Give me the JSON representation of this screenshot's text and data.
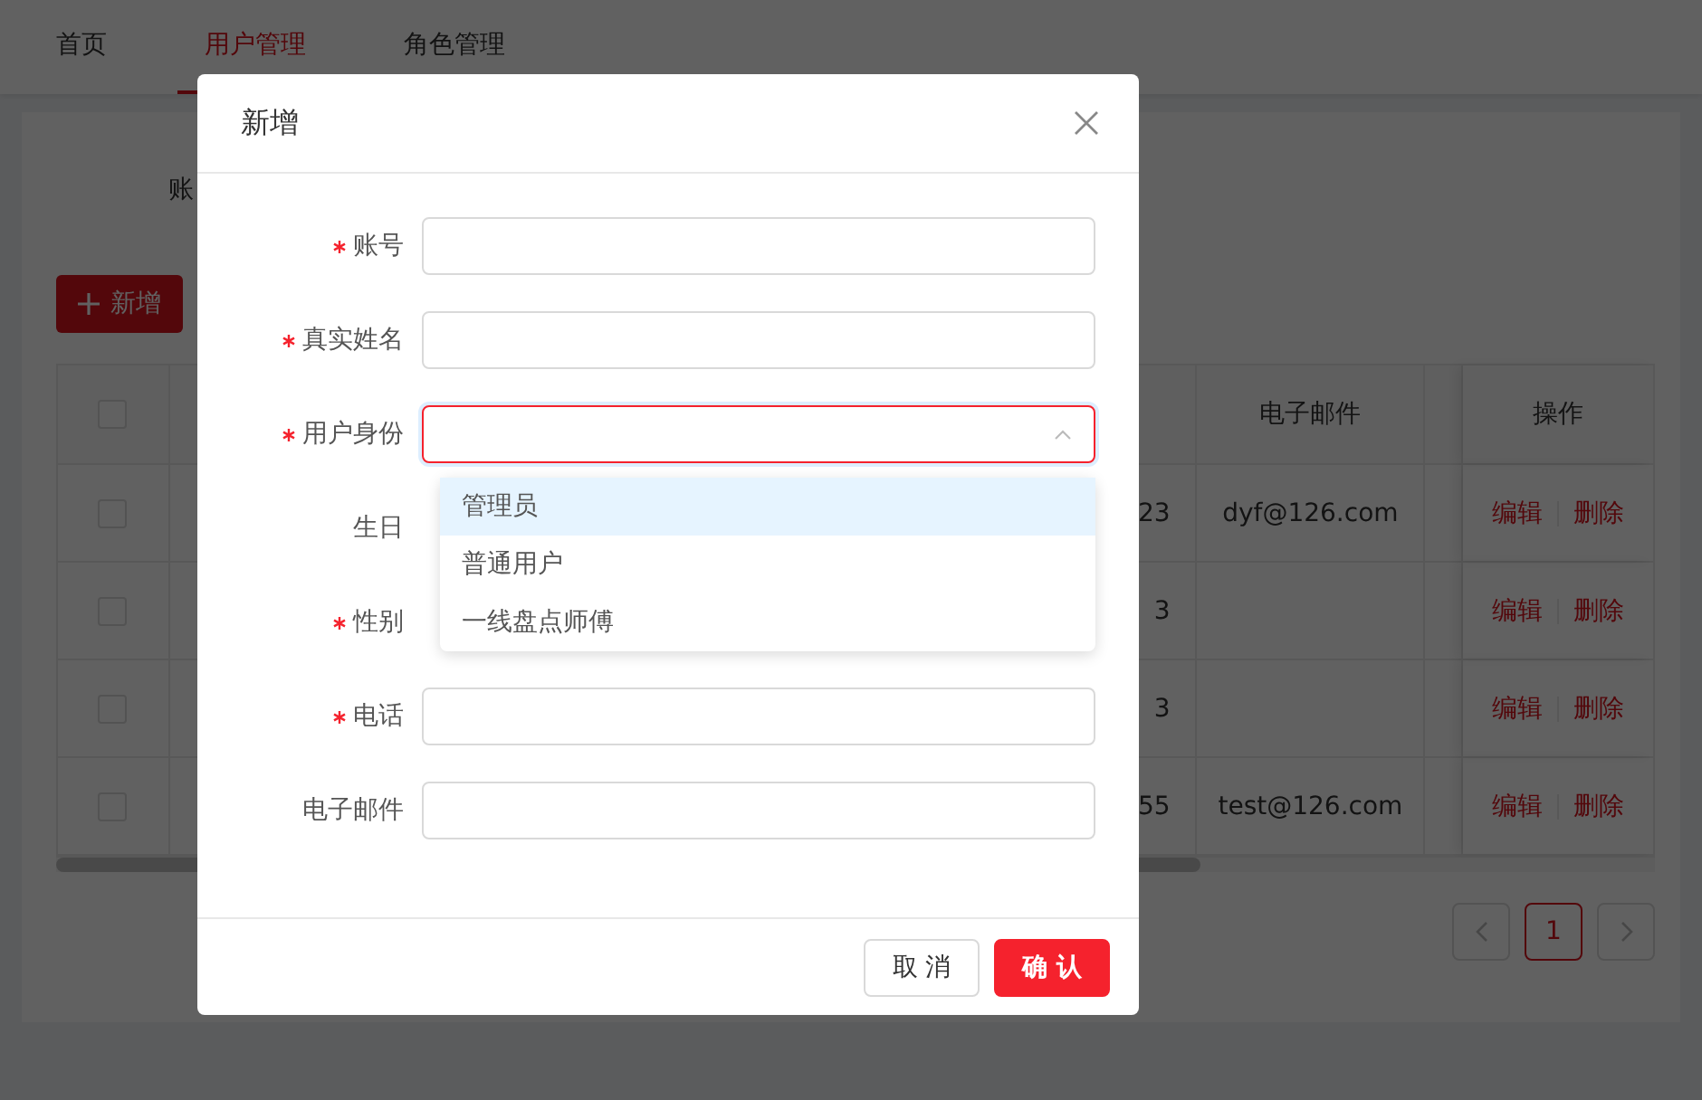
{
  "tabs": [
    {
      "label": "首页",
      "selected": false
    },
    {
      "label": "用户管理",
      "selected": true
    },
    {
      "label": "角色管理",
      "selected": false
    }
  ],
  "search_form": {
    "label": "账"
  },
  "toolbar": {
    "add_button": "新增"
  },
  "table": {
    "header_checked": false,
    "columns": [
      {
        "label": "电子邮件"
      },
      {
        "label": "操作"
      }
    ],
    "rows": [
      {
        "checked": false,
        "phone": "23",
        "email": "dyf@126.com",
        "actions": [
          "编辑",
          "删除"
        ]
      },
      {
        "checked": false,
        "phone": "3",
        "email": "",
        "actions": [
          "编辑",
          "删除"
        ]
      },
      {
        "checked": false,
        "phone": "3",
        "email": "",
        "actions": [
          "编辑",
          "删除"
        ]
      },
      {
        "checked": false,
        "phone": "55",
        "email": "test@126.com",
        "actions": [
          "编辑",
          "删除"
        ]
      }
    ]
  },
  "pagination": {
    "pages": [
      {
        "label": "1",
        "selected": true
      }
    ]
  },
  "dialog": {
    "title": "新增",
    "fields": [
      {
        "label": "账号",
        "required": true,
        "kind": "input",
        "focused": false
      },
      {
        "label": "真实姓名",
        "required": true,
        "kind": "input",
        "focused": false
      },
      {
        "label": "用户身份",
        "required": true,
        "kind": "select",
        "focused": true,
        "open": true,
        "options": [
          {
            "label": "管理员",
            "selected": true
          },
          {
            "label": "普通用户",
            "selected": false
          },
          {
            "label": "一线盘点师傅",
            "selected": false
          }
        ]
      },
      {
        "label": "生日",
        "required": false,
        "kind": "covered"
      },
      {
        "label": "性别",
        "required": true,
        "kind": "covered"
      },
      {
        "label": "电话",
        "required": true,
        "kind": "input",
        "focused": false
      },
      {
        "label": "电子邮件",
        "required": false,
        "kind": "input",
        "focused": false
      }
    ],
    "buttons": [
      {
        "label": "取 消",
        "kind": "default"
      },
      {
        "label": "确 认",
        "kind": "primary"
      }
    ]
  }
}
